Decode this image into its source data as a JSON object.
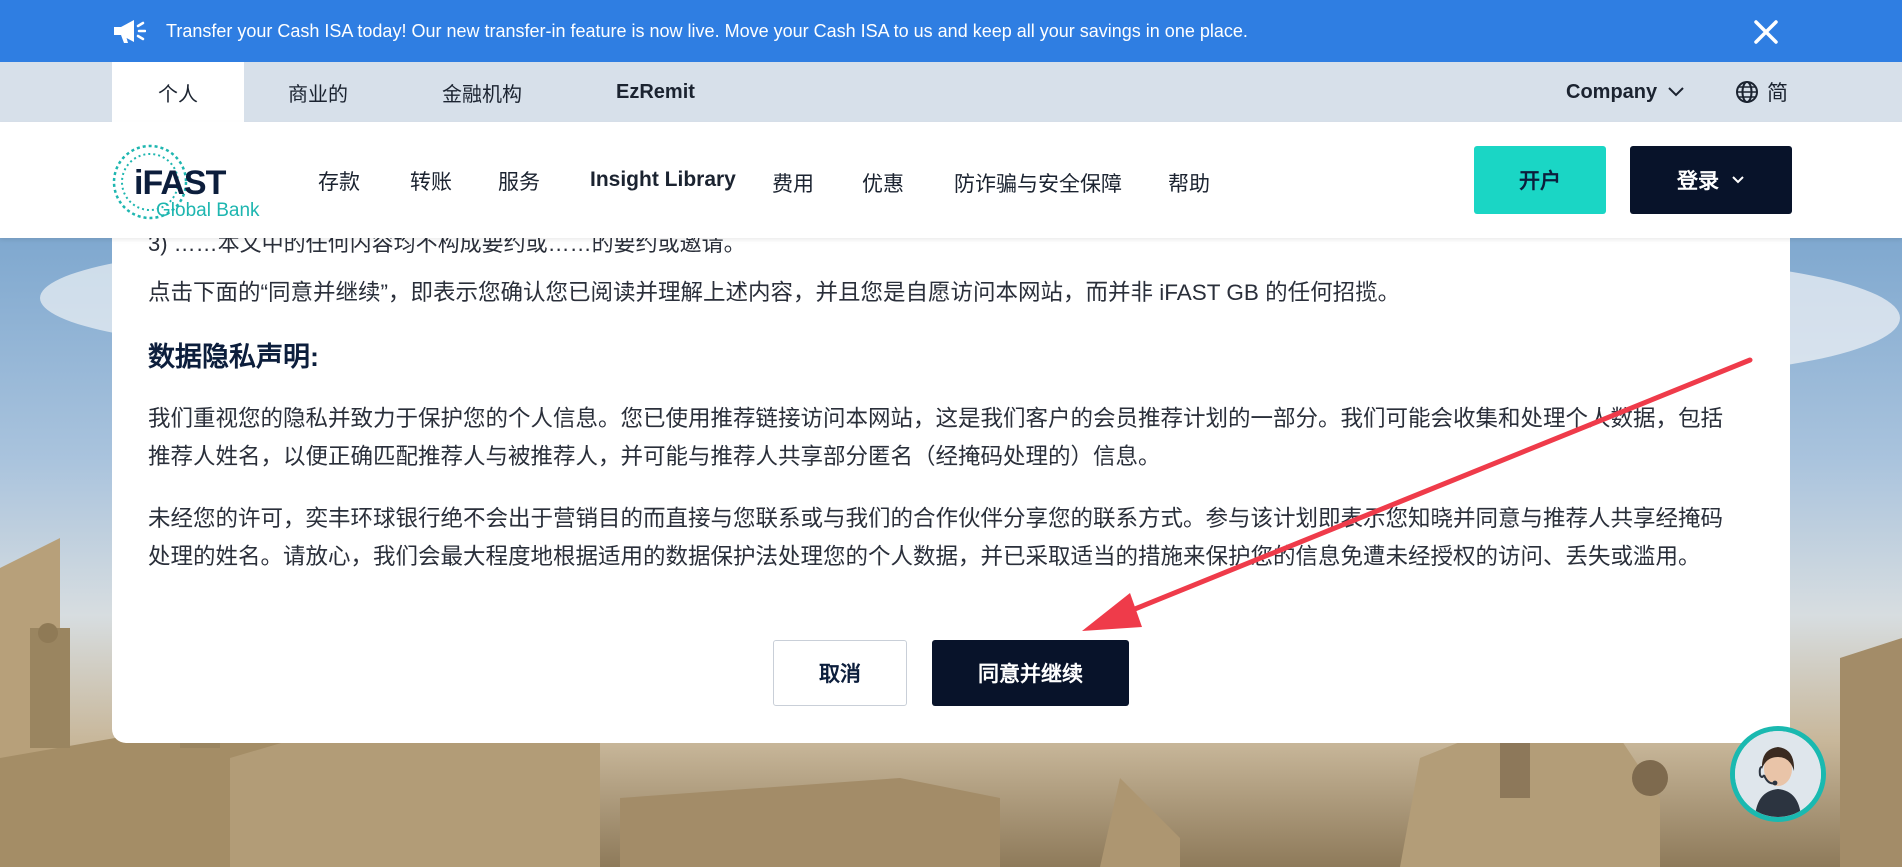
{
  "announcement": {
    "icon": "megaphone-icon",
    "text": "Transfer your Cash ISA today! Our new transfer-in feature is now live. Move your Cash ISA to us and keep all your savings in one place.",
    "close_icon": "close-icon"
  },
  "segment_nav": {
    "tabs": [
      {
        "label": "个人",
        "active": true
      },
      {
        "label": "商业的",
        "active": false
      },
      {
        "label": "金融机构",
        "active": false
      },
      {
        "label": "EzRemit",
        "active": false
      }
    ],
    "company_label": "Company",
    "language_label": "简"
  },
  "header": {
    "logo": {
      "name": "iFAST",
      "sub": "Global Bank"
    },
    "nav": [
      "存款",
      "转账",
      "服务",
      "Insight Library",
      "费用",
      "优惠",
      "防诈骗与安全保障",
      "帮助"
    ],
    "open_account_label": "开户",
    "login_label": "登录"
  },
  "modal": {
    "cut_line": "3) ……本文中的任何内容均不构成要约或……的要约或邀请。",
    "confirm_text": "点击下面的“同意并继续”，即表示您确认您已阅读并理解上述内容，并且您是自愿访问本网站，而并非 iFAST GB 的任何招揽。",
    "privacy_heading": "数据隐私声明:",
    "privacy_p1": "我们重视您的隐私并致力于保护您的个人信息。您已使用推荐链接访问本网站，这是我们客户的会员推荐计划的一部分。我们可能会收集和处理个人数据，包括推荐人姓名，以便正确匹配推荐人与被推荐人，并可能与推荐人共享部分匿名（经掩码处理的）信息。",
    "privacy_p2": "未经您的许可，奕丰环球银行绝不会出于营销目的而直接与您联系或与我们的合作伙伴分享您的联系方式。参与该计划即表示您知晓并同意与推荐人共享经掩码处理的姓名。请放心，我们会最大程度地根据适用的数据保护法处理您的个人数据，并已采取适当的措施来保护您的信息免遭未经授权的访问、丢失或滥用。",
    "cancel_label": "取消",
    "agree_label": "同意并继续"
  },
  "colors": {
    "announcement_bg": "#2f7ee2",
    "segment_bg": "#d7e0ea",
    "brand_teal": "#1ad6c5",
    "brand_navy": "#08132a",
    "annotation_red": "#ef3b4a"
  }
}
